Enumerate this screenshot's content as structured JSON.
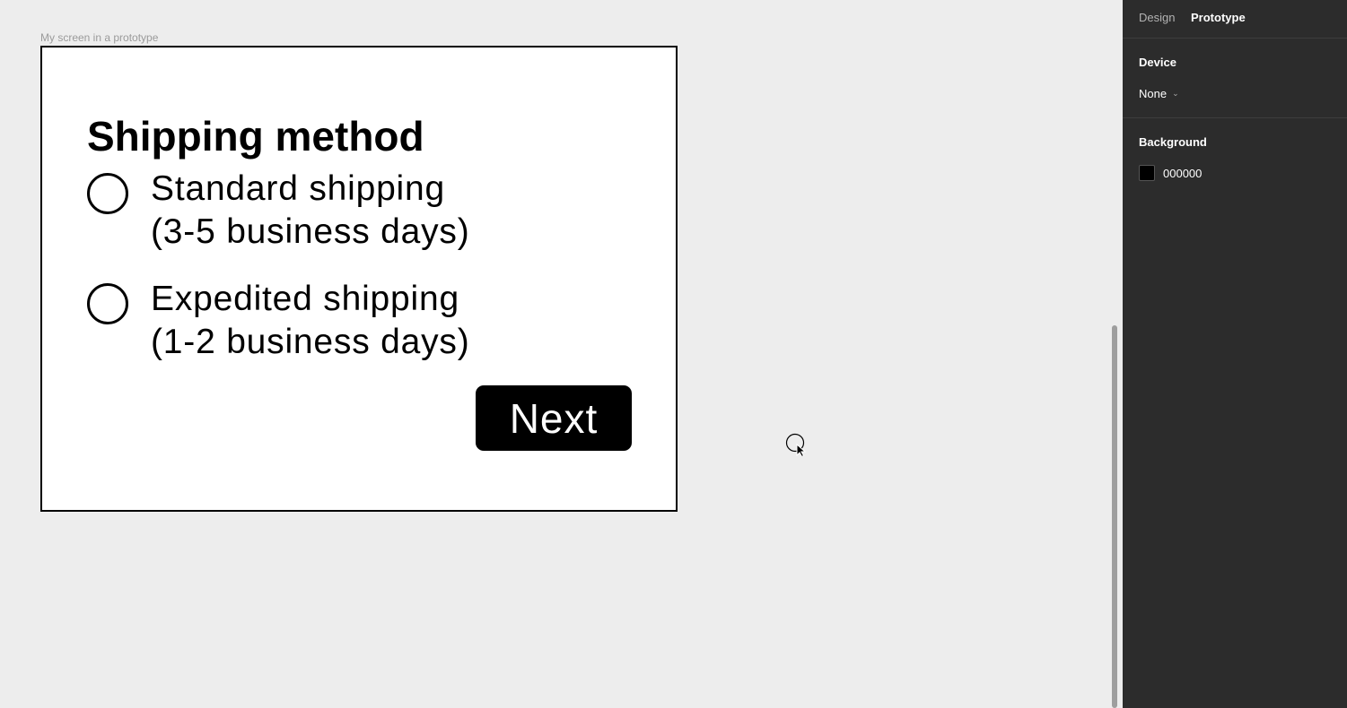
{
  "canvas": {
    "frame_label": "My screen in a prototype",
    "screen": {
      "title": "Shipping method",
      "options": [
        {
          "line1": "Standard shipping",
          "line2": "(3-5 business days)"
        },
        {
          "line1": "Expedited shipping",
          "line2": "(1-2 business days)"
        }
      ],
      "next_label": "Next"
    }
  },
  "panel": {
    "tabs": {
      "design": "Design",
      "prototype": "Prototype"
    },
    "device": {
      "title": "Device",
      "value": "None",
      "chevron": "chevron-down-icon"
    },
    "background": {
      "title": "Background",
      "hex": "000000",
      "color": "#000000"
    }
  },
  "colors": {
    "canvas_bg": "#ededed",
    "panel_bg": "#2c2c2c",
    "button_bg": "#000000"
  }
}
